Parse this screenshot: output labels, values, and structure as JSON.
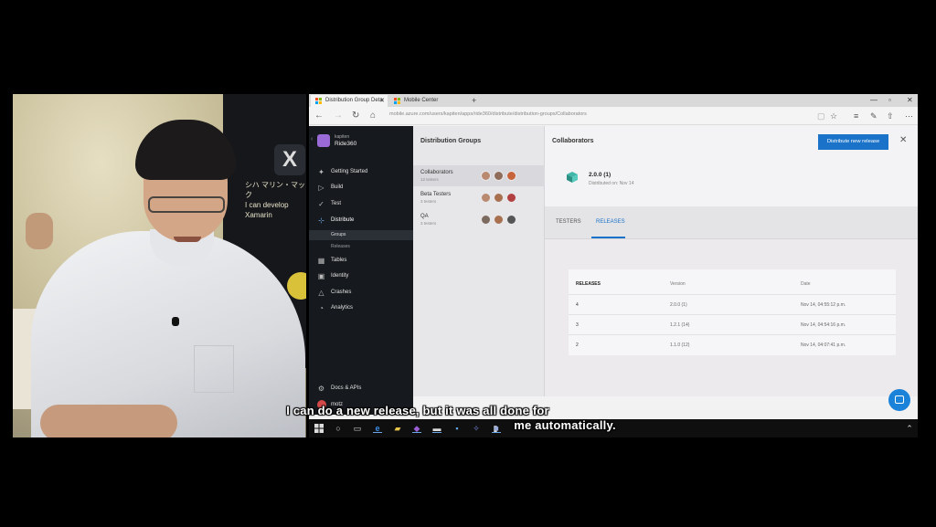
{
  "browser": {
    "tabs": [
      {
        "label": "Distribution Group Deta",
        "active": true
      },
      {
        "label": "Mobile Center",
        "active": false
      }
    ],
    "url": "mobile.azure.com/users/kapiten/apps/ride360/distribute/distribution-groups/Collaborators"
  },
  "app": {
    "owner": "kapiten",
    "name": "Ride360",
    "nav": [
      {
        "label": "Getting Started",
        "icon": "rocket-icon"
      },
      {
        "label": "Build",
        "icon": "play-icon"
      },
      {
        "label": "Test",
        "icon": "check-circle-icon"
      },
      {
        "label": "Distribute",
        "icon": "distribute-icon",
        "active": true
      },
      {
        "label": "Tables",
        "icon": "tables-icon"
      },
      {
        "label": "Identity",
        "icon": "identity-icon"
      },
      {
        "label": "Crashes",
        "icon": "warning-icon"
      },
      {
        "label": "Analytics",
        "icon": "analytics-icon"
      }
    ],
    "sub_nav": [
      {
        "label": "Groups",
        "active": true
      },
      {
        "label": "Releases"
      }
    ],
    "bottom_nav": [
      {
        "label": "Docs & APIs",
        "icon": "gear-icon"
      },
      {
        "label": "motz",
        "icon": "user-avatar"
      }
    ]
  },
  "groups_pane": {
    "title": "Distribution Groups",
    "groups": [
      {
        "name": "Collaborators",
        "sub": "12 testers",
        "active": true
      },
      {
        "name": "Beta Testers",
        "sub": "3 testers"
      },
      {
        "name": "QA",
        "sub": "3 testers"
      }
    ]
  },
  "detail": {
    "title": "Collaborators",
    "distribute_button": "Distribute new release",
    "latest_version": "2.0.0 (1)",
    "latest_distributed": "Distributed on: Nov 14",
    "tabs": [
      {
        "label": "TESTERS"
      },
      {
        "label": "RELEASES",
        "active": true
      }
    ],
    "table": {
      "headers": [
        "RELEASES",
        "Version",
        "Date"
      ],
      "rows": [
        {
          "id": "4",
          "version": "2.0.0 (1)",
          "date": "Nov 14, 04:55:12 p.m."
        },
        {
          "id": "3",
          "version": "1.2.1 (14)",
          "date": "Nov 14, 04:54:16 p.m."
        },
        {
          "id": "2",
          "version": "1.1.0 (12)",
          "date": "Nov 14, 04:07:41 p.m."
        }
      ]
    }
  },
  "webcam": {
    "banner_text": "シハ マリン・マック\nI can develop Xamarin"
  },
  "captions": {
    "line1": "I can do a new release, but it was all done for",
    "line2": "me automatically."
  },
  "colors": {
    "accent": "#1a73c9",
    "sidebar": "#16191d",
    "app_logo": "#9a6bd6"
  }
}
